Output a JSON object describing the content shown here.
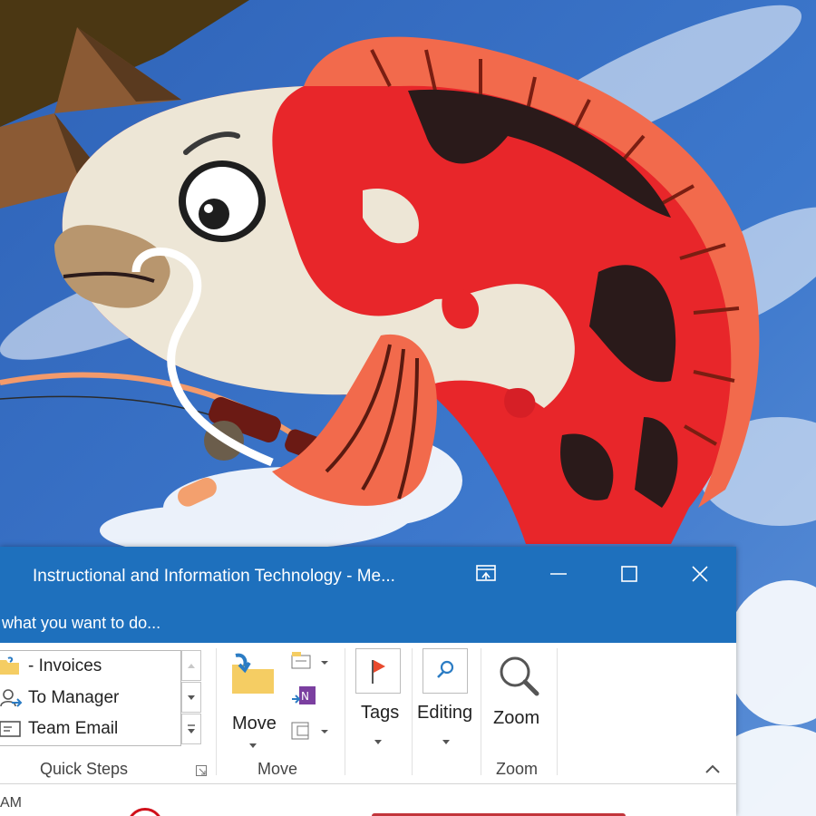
{
  "window": {
    "title": "Instructional and Information Technology - Me...",
    "tell_me": "what you want to do..."
  },
  "quick_steps": {
    "items": [
      "- Invoices",
      "To Manager",
      "Team Email"
    ],
    "label": "Quick Steps"
  },
  "move_group": {
    "move_label": "Move",
    "label": "Move"
  },
  "tags_group": {
    "tags_label": "Tags"
  },
  "editing_group": {
    "editing_label": "Editing"
  },
  "zoom_group": {
    "zoom_label": "Zoom",
    "label": "Zoom"
  },
  "message_list": {
    "time_fragment": "AM"
  },
  "colors": {
    "titlebar": "#1e70bd",
    "sky": "#3b6fc4",
    "koi_red": "#e8262a",
    "koi_cream": "#ede6d6",
    "flag_red": "#e84a2e",
    "folder_yellow": "#f5cd63"
  },
  "icons": [
    "restore-ribbon-icon",
    "minimize-icon",
    "maximize-icon",
    "close-icon",
    "folder-icon",
    "person-forward-icon",
    "mail-icon",
    "move-folder-icon",
    "onenote-icon",
    "rules-icon",
    "flag-icon",
    "search-icon",
    "magnifier-icon",
    "collapse-ribbon-icon"
  ]
}
